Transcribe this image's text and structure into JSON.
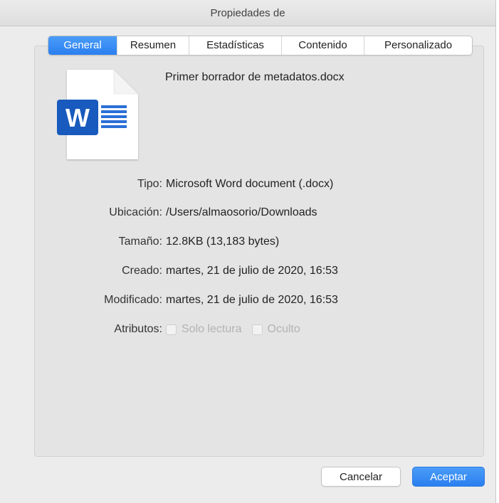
{
  "window": {
    "title": "Propiedades de"
  },
  "tabs": [
    {
      "label": "General",
      "active": true
    },
    {
      "label": "Resumen",
      "active": false
    },
    {
      "label": "Estadísticas",
      "active": false
    },
    {
      "label": "Contenido",
      "active": false
    },
    {
      "label": "Personalizado",
      "active": false
    }
  ],
  "file": {
    "name": "Primer borrador de metadatos.docx",
    "icon": "word-document-icon",
    "icon_letter": "W"
  },
  "properties": {
    "type": {
      "label": "Tipo:",
      "value": "Microsoft Word document (.docx)"
    },
    "location": {
      "label": "Ubicación:",
      "value": "/Users/almaosorio/Downloads"
    },
    "size": {
      "label": "Tamaño:",
      "value": "12.8KB (13,183 bytes)"
    },
    "created": {
      "label": "Creado:",
      "value": "martes, 21 de julio de 2020, 16:53"
    },
    "modified": {
      "label": "Modificado:",
      "value": "martes, 21 de julio de 2020, 16:53"
    },
    "attributes": {
      "label": "Atributos:",
      "read_only": {
        "label": "Solo lectura",
        "checked": false,
        "enabled": false
      },
      "hidden": {
        "label": "Oculto",
        "checked": false,
        "enabled": false
      }
    }
  },
  "buttons": {
    "cancel": "Cancelar",
    "ok": "Aceptar"
  },
  "colors": {
    "accent": "#2a7fef",
    "word_blue": "#185abd"
  }
}
